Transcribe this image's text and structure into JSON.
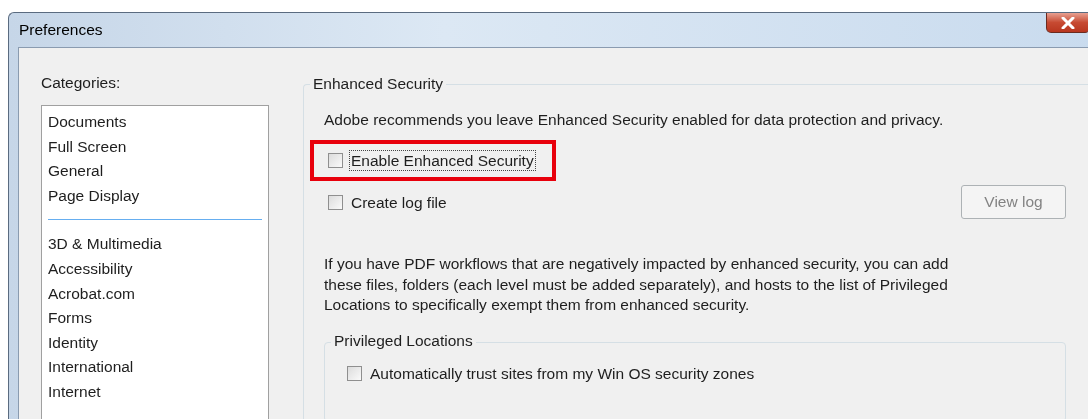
{
  "window": {
    "title": "Preferences"
  },
  "categories": {
    "label": "Categories:",
    "groups": [
      {
        "items": [
          {
            "label": "Documents",
            "selected": false
          },
          {
            "label": "Full Screen",
            "selected": false
          },
          {
            "label": "General",
            "selected": false
          },
          {
            "label": "Page Display",
            "selected": false
          }
        ]
      },
      {
        "items": [
          {
            "label": "3D & Multimedia",
            "selected": false
          },
          {
            "label": "Accessibility",
            "selected": false
          },
          {
            "label": "Acrobat.com",
            "selected": false
          },
          {
            "label": "Forms",
            "selected": false
          },
          {
            "label": "Identity",
            "selected": false
          },
          {
            "label": "International",
            "selected": false
          },
          {
            "label": "Internet",
            "selected": false
          }
        ]
      }
    ]
  },
  "enhanced_security": {
    "title": "Enhanced Security",
    "intro": "Adobe recommends you leave Enhanced Security enabled for data protection and privacy.",
    "options": [
      {
        "label": "Enable Enhanced Security",
        "checked": false,
        "focused": true,
        "highlighted": true
      },
      {
        "label": "Create log file",
        "checked": false,
        "focused": false,
        "highlighted": false
      }
    ],
    "view_log_button": {
      "label": "View log",
      "disabled": true
    },
    "note": "If you have PDF workflows that are negatively impacted by enhanced security, you can add these files, folders (each level must be added separately), and hosts to the list of Privileged Locations to specifically exempt them from enhanced security.",
    "privileged_locations": {
      "title": "Privileged Locations",
      "options": [
        {
          "label": "Automatically trust sites from my Win OS security zones",
          "checked": false
        }
      ]
    }
  }
}
